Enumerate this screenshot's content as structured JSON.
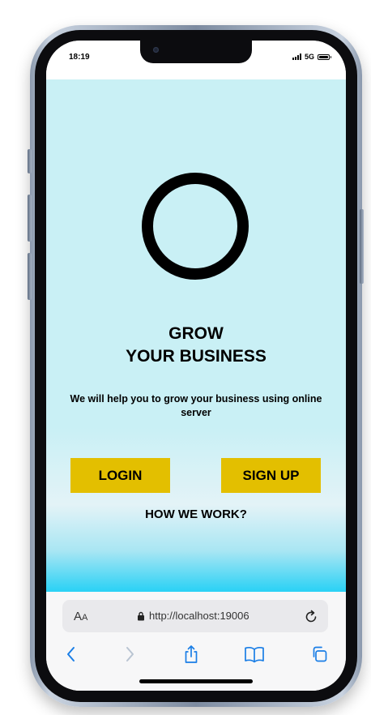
{
  "status_bar": {
    "time": "18:19",
    "network": "5G"
  },
  "app": {
    "headline_line1": "GROW",
    "headline_line2": "YOUR BUSINESS",
    "tagline": "We will help you to grow your business using online server",
    "login_label": "LOGIN",
    "signup_label": "SIGN UP",
    "how_link": "HOW WE WORK?",
    "colors": {
      "background": "#c9f0f5",
      "bottom_accent": "#29d1f5",
      "button": "#e3bf00",
      "text": "#000000"
    }
  },
  "browser": {
    "aa_big": "A",
    "aa_small": "A",
    "url": "http://localhost:19006",
    "accent": "#1a7ee6"
  }
}
